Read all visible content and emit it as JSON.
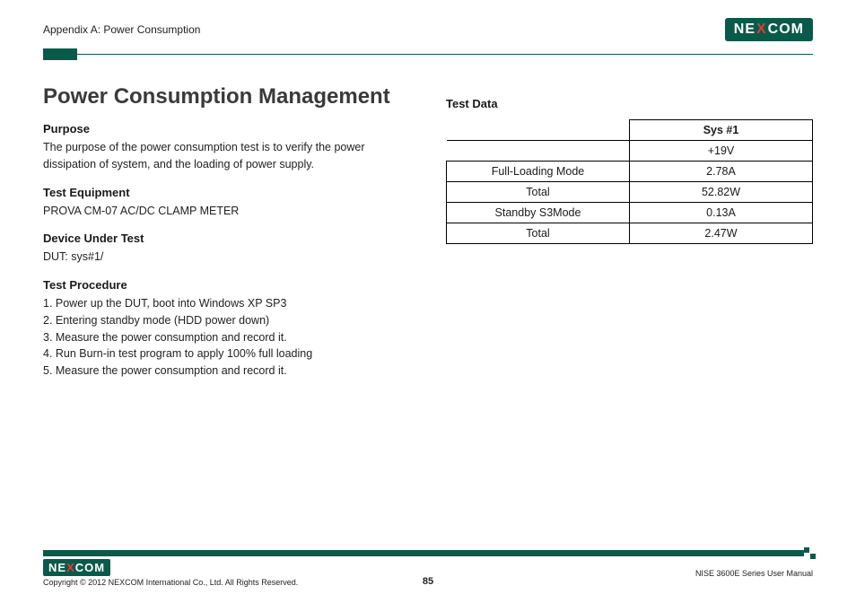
{
  "header": {
    "breadcrumb": "Appendix A: Power Consumption",
    "logo_left": "NE",
    "logo_x": "X",
    "logo_right": "COM"
  },
  "left": {
    "title": "Power Consumption Management",
    "purpose_h": "Purpose",
    "purpose_p": "The purpose of the power consumption test is to verify the power dissipation of system, and the loading of power supply.",
    "equip_h": "Test Equipment",
    "equip_p": "PROVA CM-07 AC/DC CLAMP METER",
    "dut_h": "Device Under Test",
    "dut_p": "DUT: sys#1/",
    "proc_h": "Test Procedure",
    "proc": [
      "1. Power up the DUT, boot into Windows XP SP3",
      "2. Entering standby mode (HDD power down)",
      "3. Measure the power consumption and record it.",
      "4. Run Burn-in test program to apply 100% full loading",
      "5. Measure the power consumption and record it."
    ]
  },
  "right": {
    "testdata_h": "Test Data",
    "col_header": "Sys #1",
    "rows": [
      {
        "label": "",
        "value": "+19V"
      },
      {
        "label": "Full-Loading Mode",
        "value": "2.78A"
      },
      {
        "label": "Total",
        "value": "52.82W"
      },
      {
        "label": "Standby S3Mode",
        "value": "0.13A"
      },
      {
        "label": "Total",
        "value": "2.47W"
      }
    ]
  },
  "footer": {
    "copyright": "Copyright © 2012 NEXCOM International Co., Ltd. All Rights Reserved.",
    "page": "85",
    "manual": "NISE 3600E Series User Manual"
  }
}
